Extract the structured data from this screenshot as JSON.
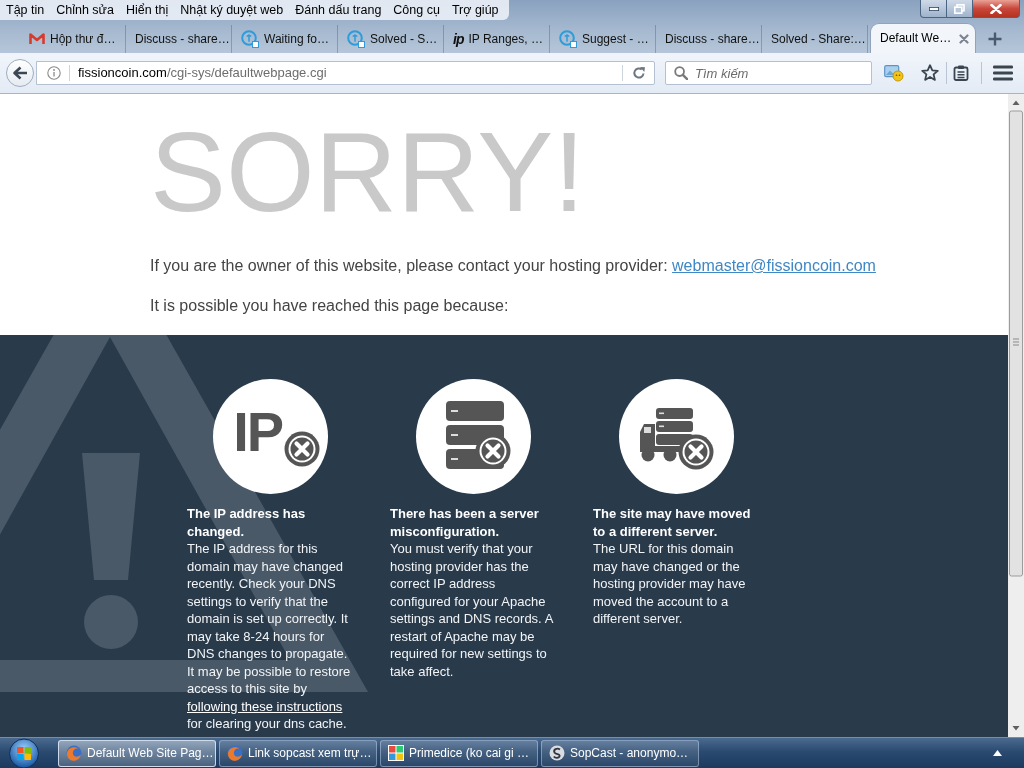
{
  "menu_bar": [
    "Tập tin",
    "Chỉnh sửa",
    "Hiển thị",
    "Nhật ký duyệt web",
    "Đánh dấu trang",
    "Công cụ",
    "Trợ giúp"
  ],
  "tabs": [
    {
      "label": "Hộp thư đ…",
      "kind": "mail",
      "selected": false
    },
    {
      "label": "Discuss - share…",
      "kind": "plain",
      "selected": false
    },
    {
      "label": "Waiting fo…",
      "kind": "ring",
      "selected": false
    },
    {
      "label": "Solved - S…",
      "kind": "ring",
      "selected": false
    },
    {
      "label": "IP Ranges, …",
      "kind": "logo",
      "logo": "ip",
      "selected": false
    },
    {
      "label": "Suggest - …",
      "kind": "ring",
      "selected": false
    },
    {
      "label": "Discuss - share…",
      "kind": "plain",
      "selected": false
    },
    {
      "label": "Solved - Share:…",
      "kind": "plain",
      "selected": false
    },
    {
      "label": "Default We…",
      "kind": "plain",
      "selected": true
    }
  ],
  "toolbar": {
    "address": {
      "domain": "fissioncoin.com",
      "path": "/cgi-sys/defaultwebpage.cgi"
    },
    "search": {
      "placeholder": "Tìm kiếm"
    }
  },
  "page": {
    "headline": "SORRY!",
    "owner_notice": {
      "text": "If you are the owner of this website, please contact your hosting provider:",
      "link": "webmaster@fissioncoin.com"
    },
    "reason_intro": "It is possible you have reached this page because:",
    "reasons": [
      {
        "kind": "ip",
        "icon_text": "IP",
        "title": "The IP address has changed.",
        "text": "The IP address for this domain may have changed recently. Check your DNS settings to verify that the domain is set up correctly. It may take 8-24 hours for DNS changes to propagate. It may be possible to restore access to this site by",
        "link": "following these instructions",
        "text_after": "for clearing your dns cache."
      },
      {
        "kind": "server",
        "title": "There has been a server misconfiguration.",
        "text": "You must verify that your hosting provider has the correct IP address configured for your Apache settings and DNS records. A restart of Apache may be required for new settings to take affect."
      },
      {
        "kind": "moved",
        "title": "The site may have moved to a different server.",
        "text": "The URL for this domain may have changed or the hosting provider may have moved the account to a different server."
      }
    ]
  },
  "taskbar": {
    "items": [
      {
        "label": "Default Web Site Pag…",
        "kind": "browser",
        "selected": true
      },
      {
        "label": "Link sopcast xem trự…",
        "kind": "browser",
        "selected": false
      },
      {
        "label": "Primedice (ko cai gi …",
        "kind": "tiles",
        "selected": false
      },
      {
        "label": "SopCast - anonymo…",
        "kind": "swirl",
        "selected": false
      }
    ]
  }
}
